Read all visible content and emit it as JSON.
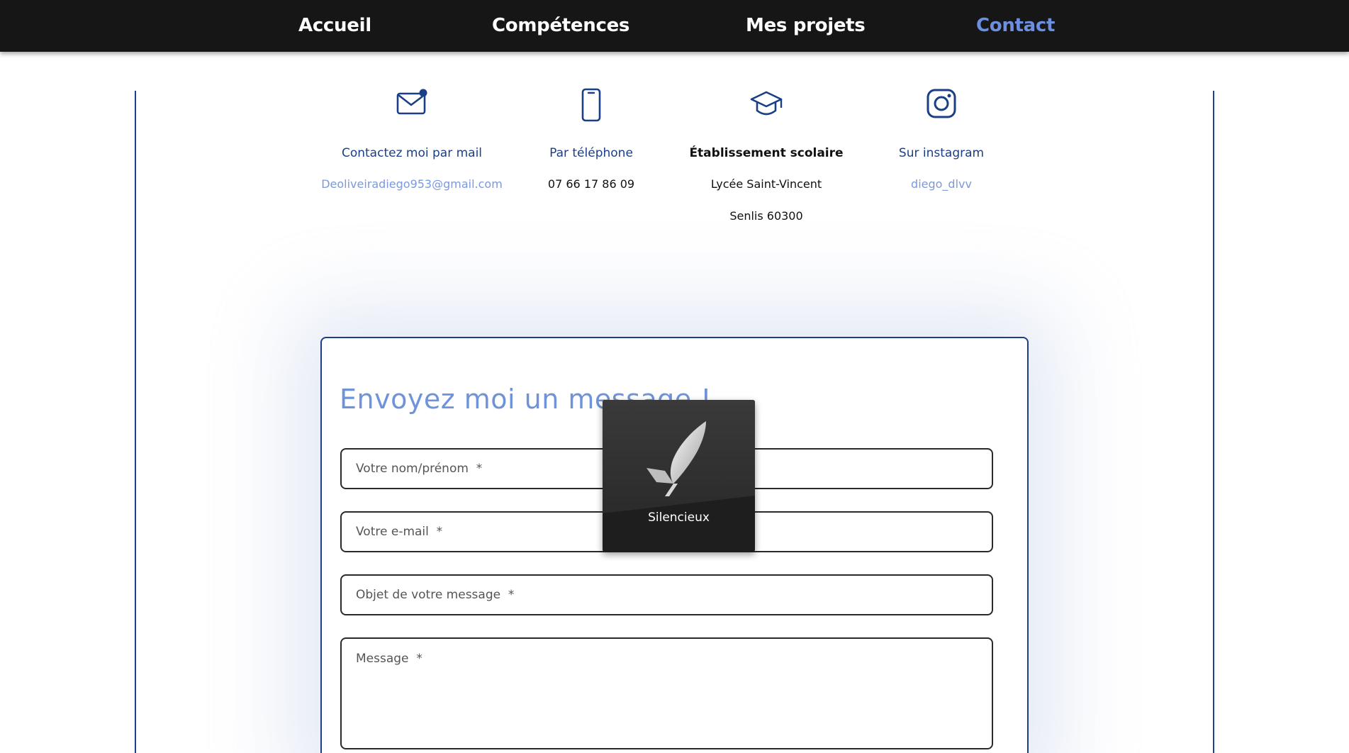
{
  "nav": {
    "items": [
      {
        "label": "Accueil",
        "active": false
      },
      {
        "label": "Compétences",
        "active": false
      },
      {
        "label": "Mes projets",
        "active": false
      },
      {
        "label": "Contact",
        "active": true
      }
    ]
  },
  "contact": {
    "mail": {
      "icon": "mail-icon",
      "label": "Contactez moi par mail",
      "value": "Deoliveiradiego953@gmail.com"
    },
    "phone": {
      "icon": "phone-icon",
      "label": "Par téléphone",
      "value": "07 66 17 86 09"
    },
    "school": {
      "icon": "graduation-cap-icon",
      "label": "Établissement scolaire",
      "line1": "Lycée Saint-Vincent",
      "line2": "Senlis 60300"
    },
    "instagram": {
      "icon": "instagram-icon",
      "label": "Sur instagram",
      "value": "diego_dlvv"
    }
  },
  "form": {
    "title": "Envoyez moi un message !",
    "name_placeholder": "Votre nom/prénom  *",
    "email_placeholder": "Votre e-mail  *",
    "subject_placeholder": "Objet de votre message  *",
    "message_placeholder": "Message  *"
  },
  "overlay": {
    "icon": "silent-mode-icon",
    "label": "Silencieux"
  },
  "colors": {
    "nav_bg": "#161616",
    "accent": "#6d8fe0",
    "border_blue": "#1a3f86",
    "link_blue": "#7b99db"
  }
}
